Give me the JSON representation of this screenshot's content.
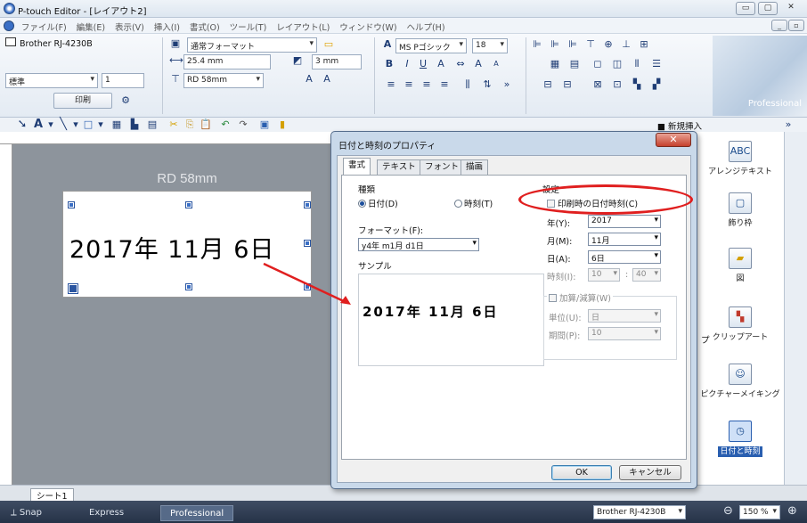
{
  "window": {
    "title": "P-touch Editor - [レイアウト2]"
  },
  "menu": [
    "ファイル(F)",
    "編集(E)",
    "表示(V)",
    "挿入(I)",
    "書式(O)",
    "ツール(T)",
    "レイアウト(L)",
    "ウィンドウ(W)",
    "ヘルプ(H)"
  ],
  "ribbon": {
    "printer": "Brother RJ-4230B",
    "quality": "標準",
    "copies": "1",
    "print_label": "印刷",
    "format": "通常フォーマット",
    "length": "25.4 mm",
    "margin": "3 mm",
    "media": "RD 58mm",
    "font": "MS Pゴシック",
    "font_size": "18",
    "mode_label": "Professional"
  },
  "toolbar": {
    "new_insert": "新規挿入"
  },
  "canvas": {
    "label_name": "RD 58mm",
    "date_text": "2017年 11月 6日",
    "sheet_tab": "シート1"
  },
  "right_panel": {
    "items": [
      "アレンジテキスト",
      "飾り枠",
      "図",
      "クリップアート",
      "ピクチャーメイキング",
      "日付と時刻"
    ],
    "partial_text": "プ"
  },
  "dialog": {
    "title": "日付と時刻のプロパティ",
    "tabs": [
      "書式",
      "テキスト",
      "フォント",
      "描画"
    ],
    "kind_label": "種類",
    "radio_date": "日付(D)",
    "radio_time": "時刻(T)",
    "format_label": "フォーマット(F):",
    "format_value": "y4年 m1月 d1日",
    "sample_label": "サンプル",
    "sample_text": "2017年 11月 6日",
    "settings_label": "設定",
    "print_time_check": "印刷時の日付時刻(C)",
    "year_label": "年(Y):",
    "year_value": "2017",
    "month_label": "月(M):",
    "month_value": "11月",
    "day_label": "日(A):",
    "day_value": "6日",
    "time_label": "時刻(I):",
    "hour_value": "10",
    "minute_value": "40",
    "calc_check": "加算/減算(W)",
    "unit_label": "単位(U):",
    "unit_value": "日",
    "period_label": "期間(P):",
    "period_value": "10",
    "ok": "OK",
    "cancel": "キャンセル"
  },
  "statusbar": {
    "snap": "Snap",
    "express": "Express",
    "professional": "Professional",
    "printer": "Brother RJ-4230B",
    "zoom": "150 %"
  },
  "colors": {
    "annotation": "#e01f1f",
    "accent": "#3a6fc6"
  }
}
